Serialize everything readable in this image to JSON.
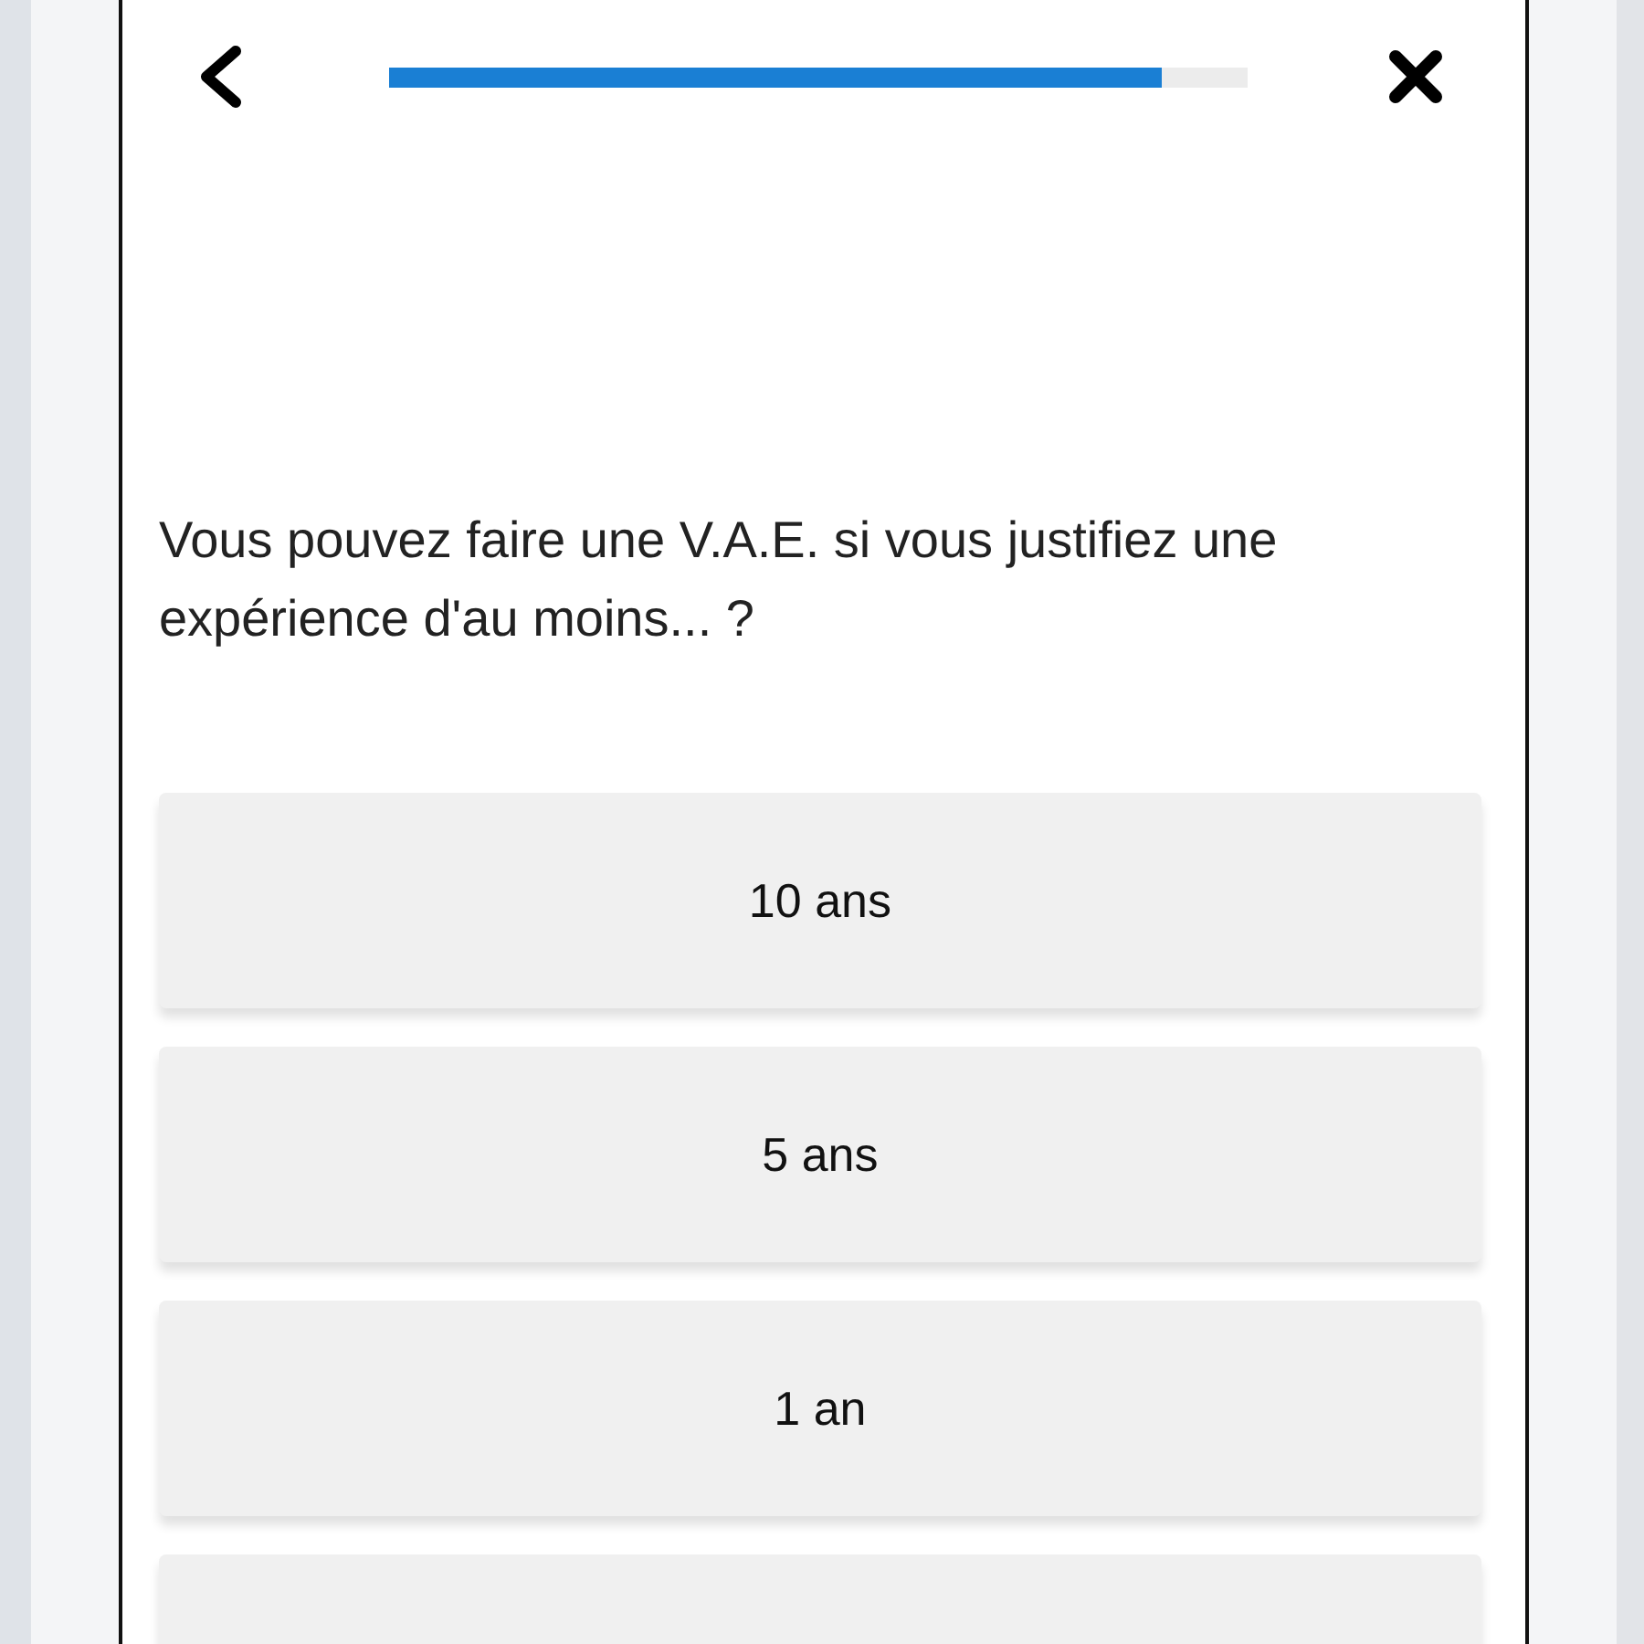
{
  "progress": {
    "level": 0.9
  },
  "question": "Vous pouvez faire une V.A.E. si vous justifiez une expérience d'au moins... ?",
  "options": [
    {
      "label": "10 ans"
    },
    {
      "label": "5 ans"
    },
    {
      "label": "1 an"
    }
  ]
}
